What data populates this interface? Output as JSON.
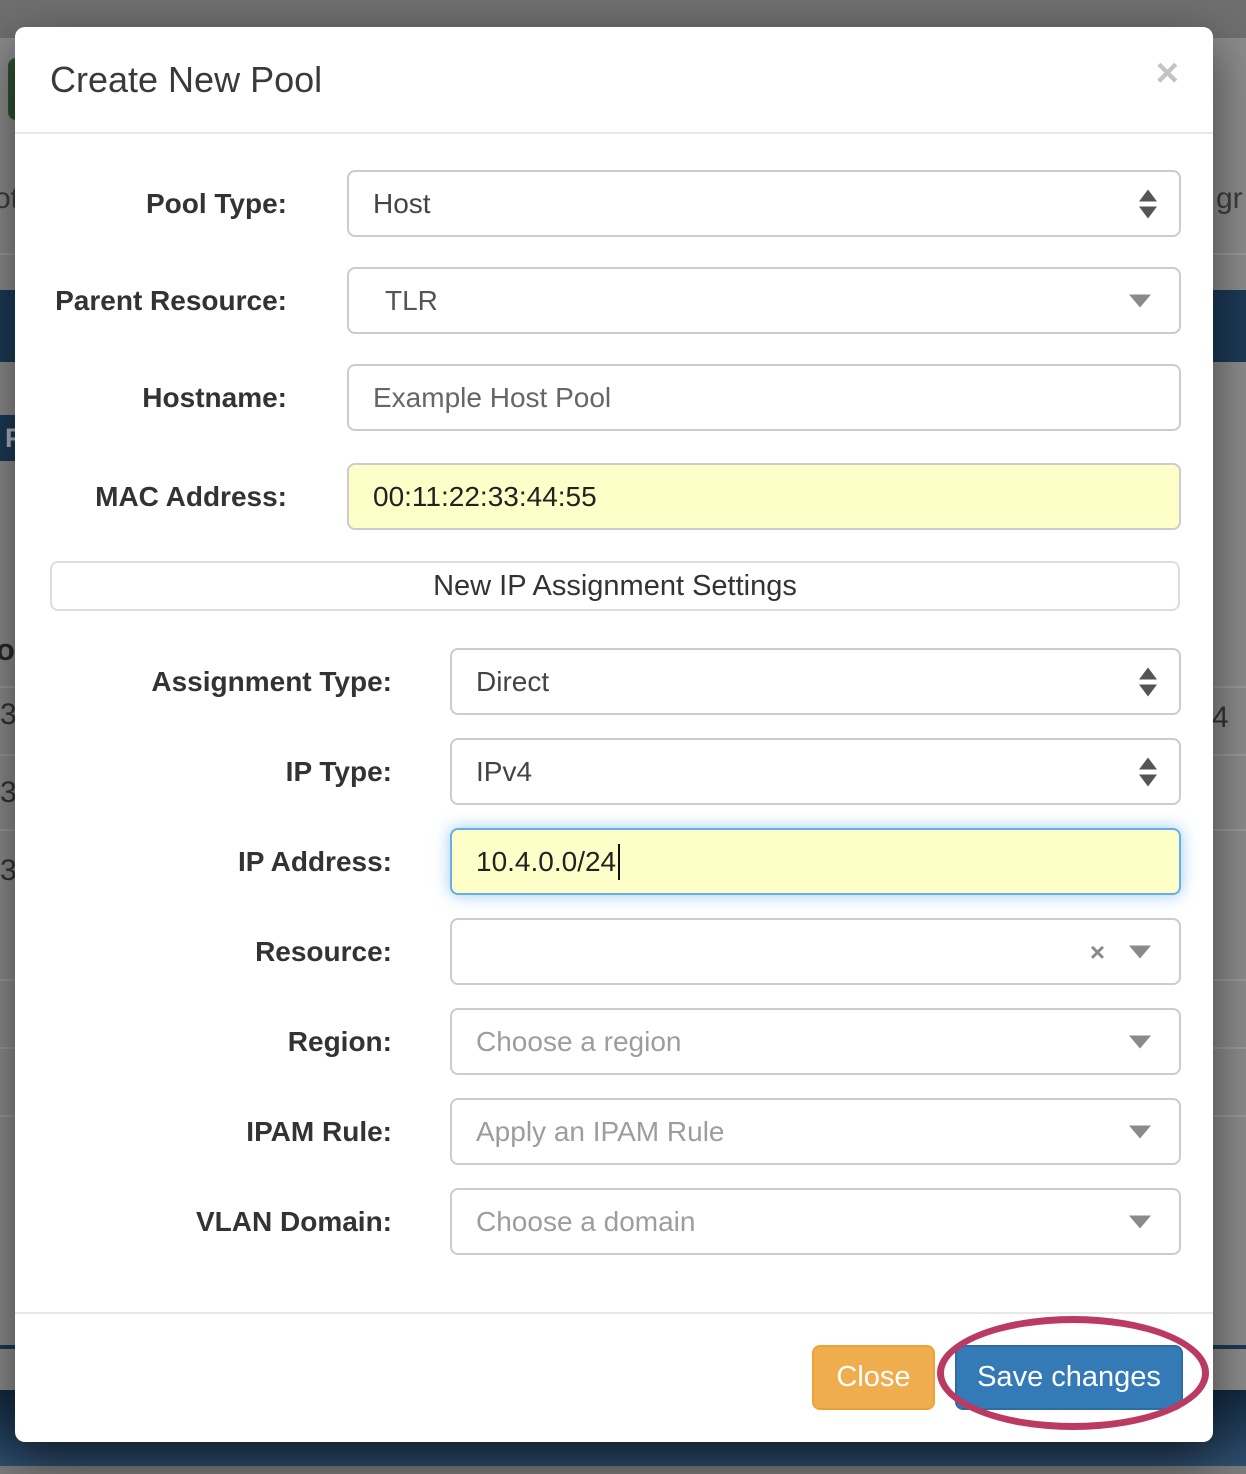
{
  "backdrop": {
    "top_left_text": "ot",
    "top_right_text": "gr",
    "navy_tab_text": "P",
    "column_header_fragment": "od",
    "left_row_numbers": [
      "3",
      "3",
      "3"
    ],
    "right_row_number": "4"
  },
  "modal": {
    "title": "Create New Pool",
    "close_icon": "×",
    "section_header": "New IP Assignment Settings",
    "fields": {
      "pool_type": {
        "label": "Pool Type:",
        "value": "Host"
      },
      "parent_resource": {
        "label": "Parent Resource:",
        "value": "TLR"
      },
      "hostname": {
        "label": "Hostname:",
        "value": "Example Host Pool"
      },
      "mac_address": {
        "label": "MAC Address:",
        "value": "00:11:22:33:44:55"
      },
      "assignment_type": {
        "label": "Assignment Type:",
        "value": "Direct"
      },
      "ip_type": {
        "label": "IP Type:",
        "value": "IPv4"
      },
      "ip_address": {
        "label": "IP Address:",
        "value": "10.4.0.0/24"
      },
      "resource": {
        "label": "Resource:",
        "value": "",
        "clear_icon": "×"
      },
      "region": {
        "label": "Region:",
        "placeholder": "Choose a region"
      },
      "ipam_rule": {
        "label": "IPAM Rule:",
        "placeholder": "Apply an IPAM Rule"
      },
      "vlan_domain": {
        "label": "VLAN Domain:",
        "placeholder": "Choose a domain"
      }
    },
    "footer": {
      "close_label": "Close",
      "save_label": "Save changes"
    }
  },
  "colors": {
    "highlight_input_bg": "#feffc8",
    "focus_border": "#66afe9",
    "close_button": "#f0ad4e",
    "save_button": "#337ab7",
    "annotation_ellipse": "#bb3a62",
    "navy_band": "#1c3a57"
  }
}
